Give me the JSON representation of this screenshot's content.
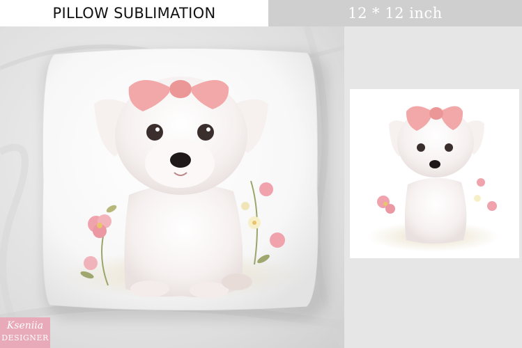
{
  "header": {
    "left_title": "PILLOW SUBLIMATION",
    "right_size": "12 * 12 inch"
  },
  "logo": {
    "line1": "Kseniia",
    "line2": "DESIGNER"
  },
  "colors": {
    "bow_pink": "#f2a8a8",
    "flower_pink": "#f0a3ad",
    "logo_pink": "#e8a9b8",
    "header_gray": "#cfcfcf"
  }
}
